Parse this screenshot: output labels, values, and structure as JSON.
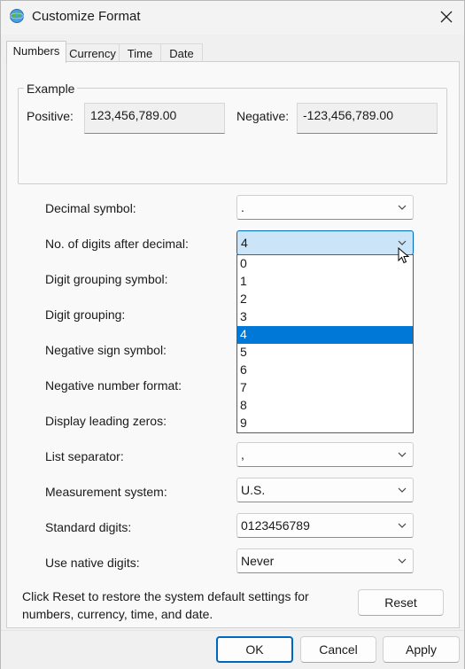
{
  "window": {
    "title": "Customize Format",
    "close_icon": "close-icon",
    "app_icon": "globe-icon"
  },
  "tabs": [
    {
      "label": "Numbers",
      "active": true
    },
    {
      "label": "Currency",
      "active": false
    },
    {
      "label": "Time",
      "active": false
    },
    {
      "label": "Date",
      "active": false
    }
  ],
  "example": {
    "legend": "Example",
    "positive_label": "Positive:",
    "positive_value": "123,456,789.00",
    "negative_label": "Negative:",
    "negative_value": "-123,456,789.00"
  },
  "settings": [
    {
      "label": "Decimal symbol:",
      "value": "."
    },
    {
      "label": "No. of digits after decimal:",
      "value": "4"
    },
    {
      "label": "Digit grouping symbol:",
      "value": ""
    },
    {
      "label": "Digit grouping:",
      "value": ""
    },
    {
      "label": "Negative sign symbol:",
      "value": ""
    },
    {
      "label": "Negative number format:",
      "value": ""
    },
    {
      "label": "Display leading zeros:",
      "value": ""
    },
    {
      "label": "List separator:",
      "value": ","
    },
    {
      "label": "Measurement system:",
      "value": "U.S."
    },
    {
      "label": "Standard digits:",
      "value": "0123456789"
    },
    {
      "label": "Use native digits:",
      "value": "Never"
    }
  ],
  "dropdown": {
    "options": [
      "0",
      "1",
      "2",
      "3",
      "4",
      "5",
      "6",
      "7",
      "8",
      "9"
    ],
    "selected": "4"
  },
  "reset": {
    "note": "Click Reset to restore the system default settings for numbers, currency, time, and date.",
    "button": "Reset"
  },
  "footer": {
    "ok": "OK",
    "cancel": "Cancel",
    "apply": "Apply"
  },
  "colors": {
    "accent": "#0078d7",
    "focus_fill": "#cce4f7",
    "background": "#f0f0f0"
  }
}
